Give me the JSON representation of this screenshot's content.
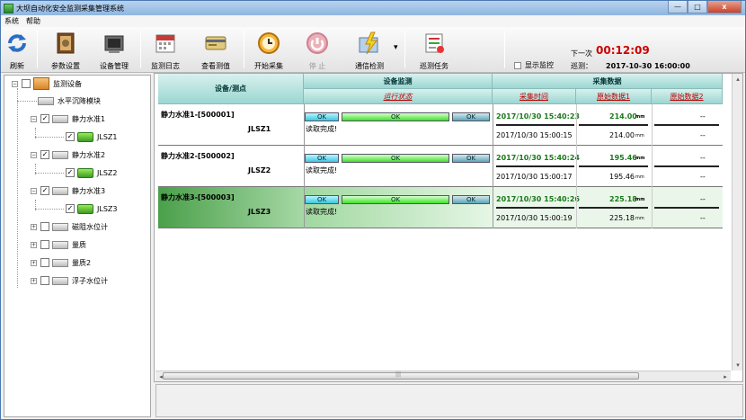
{
  "window": {
    "title": "大坝自动化安全监测采集管理系统",
    "min": "—",
    "max": "□",
    "close": "x"
  },
  "menu": [
    "系统",
    "帮助"
  ],
  "toolbar": {
    "buttons": [
      {
        "label": "刷新",
        "icon": "refresh-icon"
      },
      {
        "label": "参数设置",
        "icon": "settings-book-icon"
      },
      {
        "label": "设备管理",
        "icon": "device-manage-icon"
      },
      {
        "label": "监测日志",
        "icon": "calendar-icon"
      },
      {
        "label": "查看测值",
        "icon": "card-icon"
      },
      {
        "label": "开始采集",
        "icon": "clock-start-icon"
      },
      {
        "label": "停  止",
        "icon": "stop-icon"
      },
      {
        "label": "通信检测",
        "icon": "lightning-icon"
      },
      {
        "label": "巡测任务",
        "icon": "task-icon"
      }
    ],
    "dropdown_arrow": "▾"
  },
  "monitor_toggle": {
    "label": "显示监控"
  },
  "schedule": {
    "next_label": "下一次",
    "countdown": "00:12:09",
    "period_label": "巡测：",
    "period_value": "2017-10-30 16:00:00"
  },
  "tree": {
    "root": "监测设备",
    "items": [
      {
        "label": "水平沉降模块",
        "level": 1
      },
      {
        "label": "静力水准1",
        "level": 1
      },
      {
        "label": "JLSZ1",
        "level": 2
      },
      {
        "label": "静力水准2",
        "level": 1
      },
      {
        "label": "JLSZ2",
        "level": 2
      },
      {
        "label": "静力水准3",
        "level": 1
      },
      {
        "label": "JLSZ3",
        "level": 2
      },
      {
        "label": "磁阻水位计",
        "level": 1
      },
      {
        "label": "量质",
        "level": 1
      },
      {
        "label": "量质2",
        "level": 1
      },
      {
        "label": "浮子水位计",
        "level": 1
      }
    ]
  },
  "grid": {
    "headers": {
      "device": "设备/测点",
      "monitor": "设备监测",
      "run_state": "运行状态",
      "data": "采集数据",
      "time": "采集时间",
      "raw1": "原始数据1",
      "raw2": "原始数据2"
    },
    "rows": [
      {
        "device": "静力水准1-[500001]",
        "point": "JLSZ1",
        "s1": "OK",
        "s2": "OK",
        "s3": "OK",
        "msg": "读取完成!",
        "t1": "2017/10/30 15:40:23",
        "v1": "214.00",
        "u1": "mm",
        "t2": "2017/10/30 15:00:15",
        "v2": "214.00",
        "u2": "mm",
        "r1": "--",
        "r2": "--"
      },
      {
        "device": "静力水准2-[500002]",
        "point": "JLSZ2",
        "s1": "OK",
        "s2": "OK",
        "s3": "OK",
        "msg": "读取完成!",
        "t1": "2017/10/30 15:40:24",
        "v1": "195.46",
        "u1": "mm",
        "t2": "2017/10/30 15:00:17",
        "v2": "195.46",
        "u2": "mm",
        "r1": "--",
        "r2": "--"
      },
      {
        "device": "静力水准3-[500003]",
        "point": "JLSZ3",
        "s1": "OK",
        "s2": "OK",
        "s3": "OK",
        "msg": "读取完成!",
        "t1": "2017/10/30 15:40:26",
        "v1": "225.18",
        "u1": "mm",
        "t2": "2017/10/30 15:00:19",
        "v2": "225.18",
        "u2": "mm",
        "r1": "--",
        "r2": "--"
      }
    ]
  },
  "scroll": {
    "left": "◂",
    "right": "▸",
    "up": "▴",
    "down": "▾",
    "grip": "|||"
  },
  "colors": {
    "header": "#9cd6d2",
    "selected_row": "#5fb25f",
    "value_green": "#1a7a1a"
  }
}
